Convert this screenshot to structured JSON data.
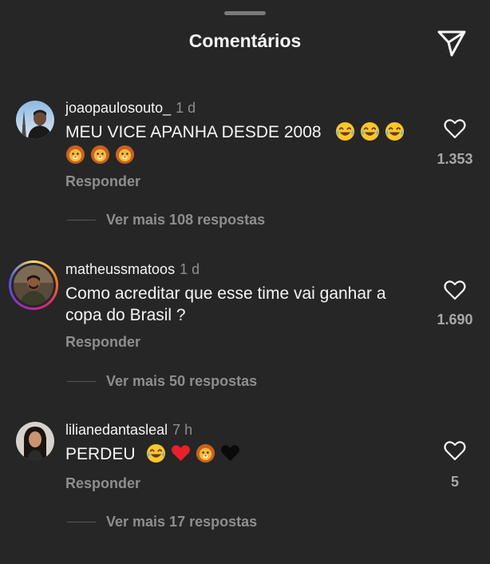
{
  "header": {
    "title": "Comentários"
  },
  "comments": [
    {
      "username": "joaopaulosouto_",
      "time": "1 d",
      "text_line1": "MEU VICE APANHA DESDE 2008",
      "likes": "1.353",
      "reply_label": "Responder",
      "more_replies": "Ver mais 108 respostas",
      "emojis_line1": [
        "laughing-face",
        "laughing-face",
        "laughing-face"
      ],
      "emojis_line2": [
        "lion-face",
        "lion-face",
        "lion-face"
      ]
    },
    {
      "username": "matheussmatoos",
      "time": "1 d",
      "text_line1": "Como acreditar que esse time vai ganhar a",
      "text_line2": "copa do Brasil ?",
      "likes": "1.690",
      "reply_label": "Responder",
      "more_replies": "Ver mais 50 respostas"
    },
    {
      "username": "lilianedantasleal",
      "time": "7 h",
      "text_line1": "PERDEU",
      "likes": "5",
      "reply_label": "Responder",
      "more_replies": "Ver mais 17 respostas",
      "emojis_line1": [
        "laughing-face",
        "red-heart",
        "lion-face",
        "black-heart"
      ]
    }
  ],
  "colors": {
    "background": "#262626",
    "primary_text": "#f5f5f5",
    "secondary_text": "#8e8e8e",
    "likes_text": "#a8a8a8"
  }
}
